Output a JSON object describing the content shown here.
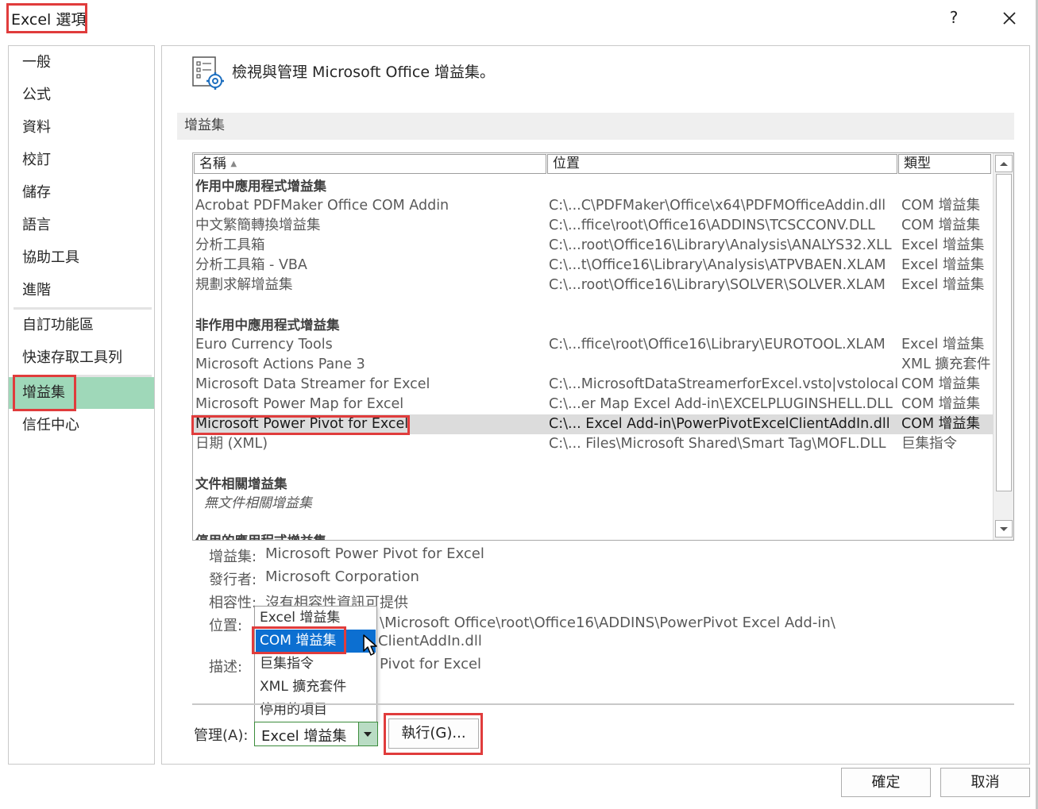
{
  "window": {
    "title": "Excel 選項",
    "help": "?"
  },
  "nav": {
    "items": [
      {
        "label": "一般"
      },
      {
        "label": "公式"
      },
      {
        "label": "資料"
      },
      {
        "label": "校訂"
      },
      {
        "label": "儲存"
      },
      {
        "label": "語言"
      },
      {
        "label": "協助工具"
      },
      {
        "label": "進階"
      },
      {
        "label": "自訂功能區"
      },
      {
        "label": "快速存取工具列"
      },
      {
        "label": "增益集"
      },
      {
        "label": "信任中心"
      }
    ],
    "selected": "增益集"
  },
  "content": {
    "header": "檢視與管理 Microsoft Office 增益集。",
    "section_title": "增益集",
    "columns": {
      "name": "名稱",
      "location": "位置",
      "type": "類型"
    },
    "active_group": {
      "title": "作用中應用程式增益集",
      "rows": [
        {
          "name": "Acrobat PDFMaker Office COM Addin",
          "location": "C:\\...C\\PDFMaker\\Office\\x64\\PDFMOfficeAddin.dll",
          "type": "COM 增益集"
        },
        {
          "name": "中文繁簡轉換增益集",
          "location": "C:\\...ffice\\root\\Office16\\ADDINS\\TCSCCONV.DLL",
          "type": "COM 增益集"
        },
        {
          "name": "分析工具箱",
          "location": "C:\\...root\\Office16\\Library\\Analysis\\ANALYS32.XLL",
          "type": "Excel 增益集"
        },
        {
          "name": "分析工具箱 - VBA",
          "location": "C:\\...t\\Office16\\Library\\Analysis\\ATPVBAEN.XLAM",
          "type": "Excel 增益集"
        },
        {
          "name": "規劃求解增益集",
          "location": "C:\\...root\\Office16\\Library\\SOLVER\\SOLVER.XLAM",
          "type": "Excel 增益集"
        }
      ]
    },
    "inactive_group": {
      "title": "非作用中應用程式增益集",
      "rows": [
        {
          "name": "Euro Currency Tools",
          "location": "C:\\...ffice\\root\\Office16\\Library\\EUROTOOL.XLAM",
          "type": "Excel 增益集"
        },
        {
          "name": "Microsoft Actions Pane 3",
          "location": "",
          "type": "XML 擴充套件"
        },
        {
          "name": "Microsoft Data Streamer for Excel",
          "location": "C:\\...MicrosoftDataStreamerforExcel.vsto|vstolocal",
          "type": "COM 增益集"
        },
        {
          "name": "Microsoft Power Map for Excel",
          "location": "C:\\...er Map Excel Add-in\\EXCELPLUGINSHELL.DLL",
          "type": "COM 增益集"
        },
        {
          "name": "Microsoft Power Pivot for Excel",
          "location": "C:\\... Excel Add-in\\PowerPivotExcelClientAddIn.dll",
          "type": "COM 增益集"
        },
        {
          "name": "日期 (XML)",
          "location": "C:\\... Files\\Microsoft Shared\\Smart Tag\\MOFL.DLL",
          "type": "巨集指令"
        }
      ]
    },
    "document_group": {
      "title": "文件相關增益集",
      "empty_note": "無文件相關增益集"
    },
    "disabled_group_title_partial": "停用的應用程式增益集",
    "details": {
      "addin_label": "增益集:",
      "addin_value": "Microsoft Power Pivot for Excel",
      "publisher_label": "發行者:",
      "publisher_value": "Microsoft Corporation",
      "compat_label": "相容性:",
      "compat_value": "沒有相容性資訊可提供",
      "location_label": "位置:",
      "location_value_line1": "\\Microsoft Office\\root\\Office16\\ADDINS\\PowerPivot Excel Add-in\\",
      "location_value_line2": "ClientAddIn.dll",
      "desc_label": "描述:",
      "desc_value": "Pivot for Excel"
    },
    "manage": {
      "label": "管理(A):",
      "selected": "Excel 增益集",
      "options": [
        "Excel 增益集",
        "COM 增益集",
        "巨集指令",
        "XML 擴充套件",
        "停用的項目"
      ],
      "highlighted_option": "COM 增益集",
      "go_button": "執行(G)..."
    }
  },
  "footer": {
    "ok": "確定",
    "cancel": "取消"
  },
  "colors": {
    "nav_selected_bg": "#9fd8b9",
    "highlight_box": "#e03c3c",
    "dropdown_selected_bg": "#0c6fd1",
    "row_selected_bg": "#dcdcdc"
  }
}
